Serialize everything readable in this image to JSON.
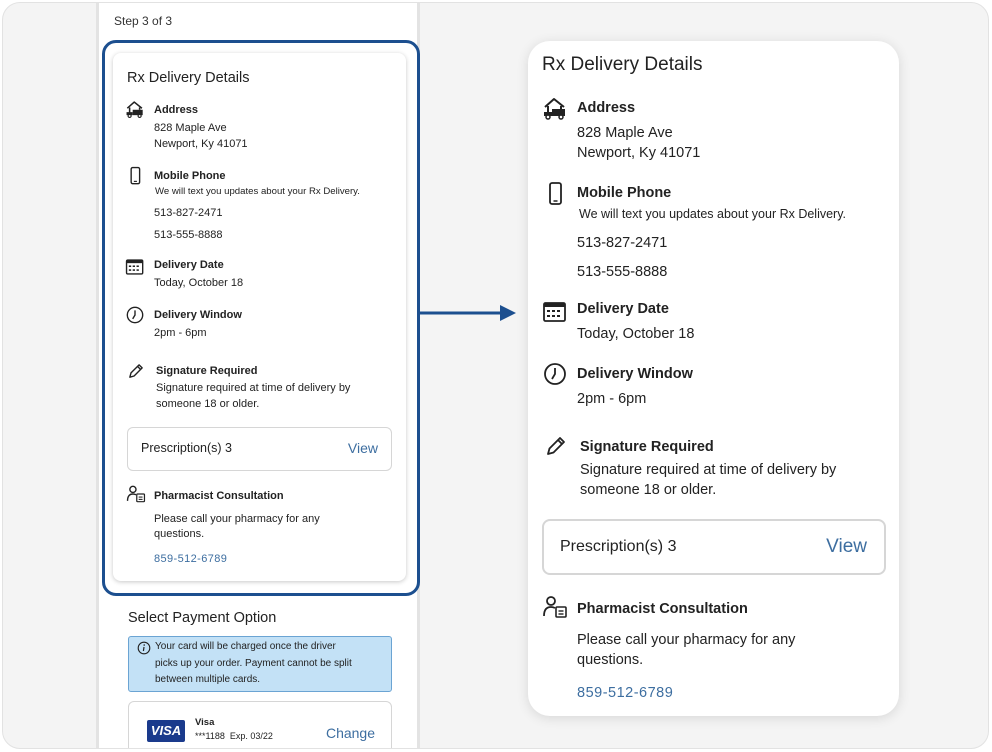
{
  "step_label": "Step 3 of 3",
  "rx": {
    "title": "Rx Delivery Details",
    "address": {
      "heading": "Address",
      "line1": "828 Maple Ave",
      "line2": "Newport, Ky 41071",
      "icon": "house-delivery-icon"
    },
    "phone": {
      "heading": "Mobile Phone",
      "note": "We will text you updates about your Rx Delivery.",
      "number1": "513-827-2471",
      "number2": "513-555-8888",
      "icon": "mobile-phone-icon"
    },
    "date": {
      "heading": "Delivery Date",
      "value": "Today, October 18",
      "icon": "calendar-icon"
    },
    "window": {
      "heading": "Delivery Window",
      "value": "2pm - 6pm",
      "icon": "clock-icon"
    },
    "signature": {
      "heading": "Signature Required",
      "line1": "Signature required at time of delivery by",
      "line2": "someone 18 or older.",
      "icon": "pencil-icon"
    },
    "prescriptions": {
      "label": "Prescription(s) 3",
      "action": "View"
    },
    "pharmacist": {
      "heading": "Pharmacist Consultation",
      "line1": "Please call your pharmacy for any",
      "line2": "questions.",
      "phone": "859-512-6789",
      "icon": "pharmacist-icon"
    }
  },
  "payment": {
    "title": "Select Payment Option",
    "info_line1": "Your card will be charged once the driver",
    "info_line2": "picks up your order. Payment cannot be split",
    "info_line3": "between multiple cards.",
    "card_brand": "Visa",
    "card_logo_text": "VISA",
    "card_number": "***1188",
    "card_exp": "Exp. 03/22",
    "change_label": "Change"
  },
  "colors": {
    "highlight_border": "#1c4f8f",
    "link": "#3d6ea0",
    "info_bg": "#c3e1f6",
    "visa_blue": "#1a3a8c"
  }
}
